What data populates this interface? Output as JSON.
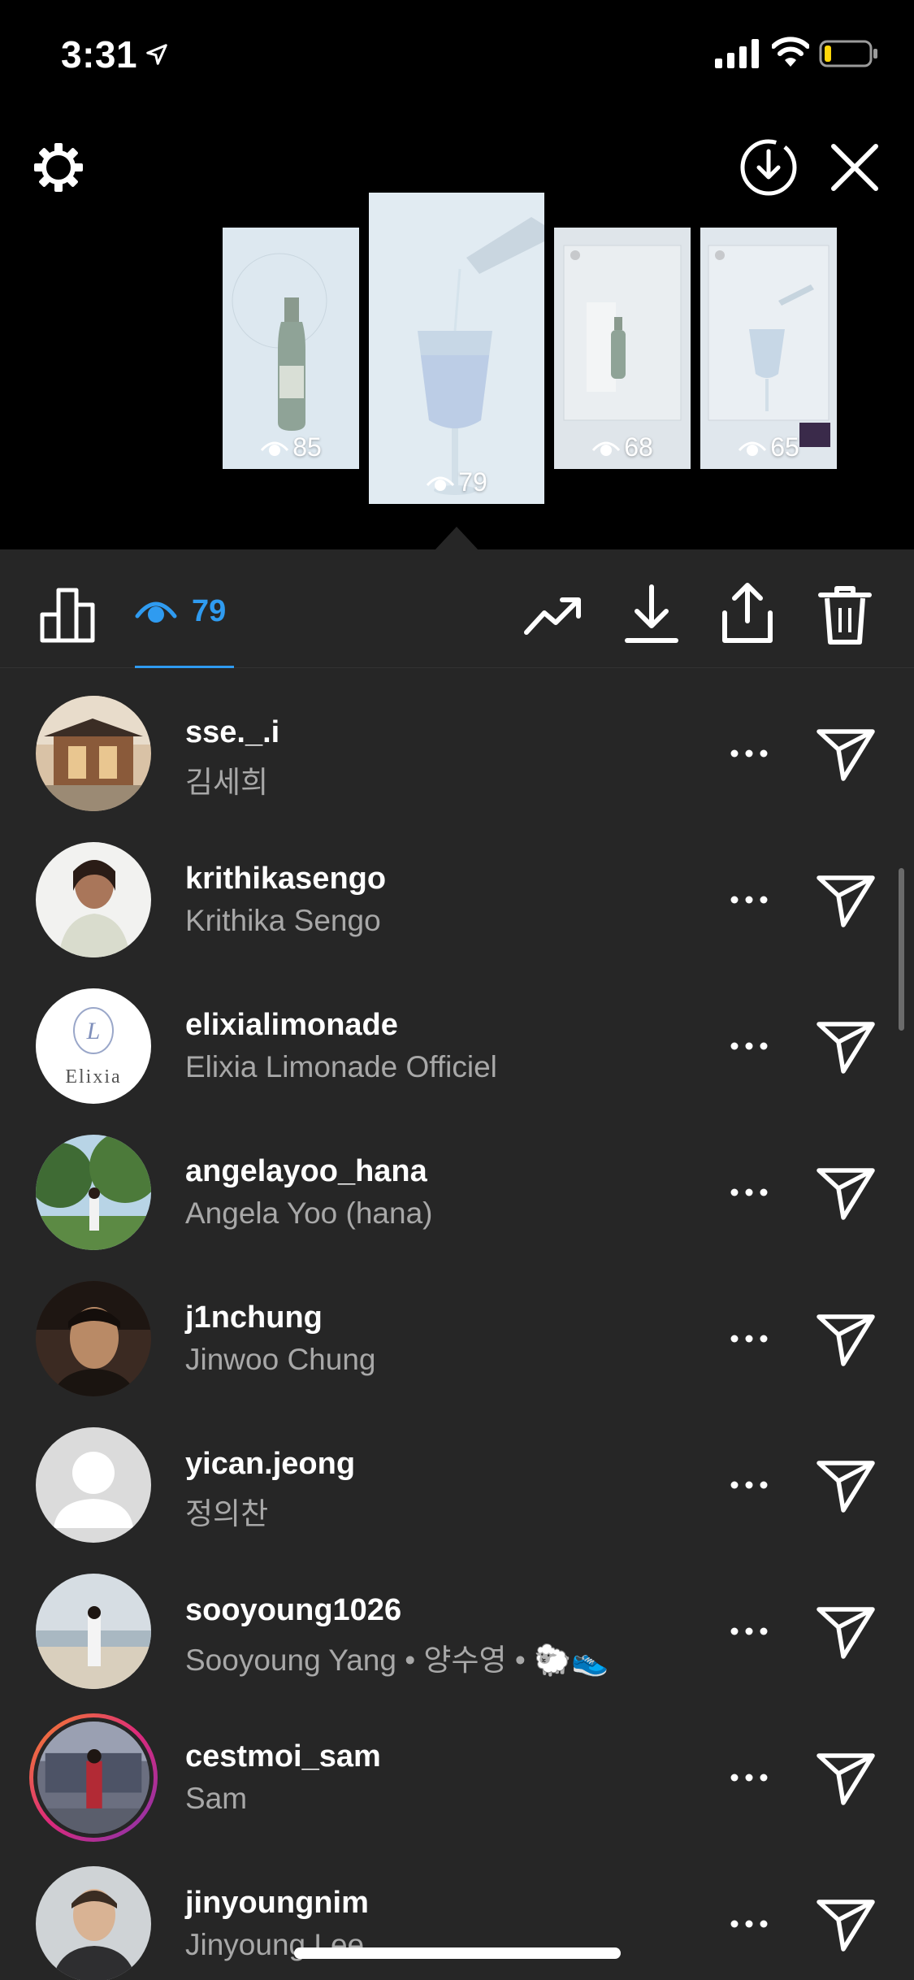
{
  "status_bar": {
    "time": "3:31"
  },
  "stories": [
    {
      "views": "85"
    },
    {
      "views": "79"
    },
    {
      "views": "68"
    },
    {
      "views": "65"
    }
  ],
  "toolbar": {
    "viewers_count": "79",
    "accent": "#2f9bf0"
  },
  "viewers": [
    {
      "username": "sse._.i",
      "full_name": "김세희"
    },
    {
      "username": "krithikasengo",
      "full_name": "Krithika Sengo"
    },
    {
      "username": "elixialimonade",
      "full_name": "Elixia Limonade Officiel",
      "avatar_text": "Elixia"
    },
    {
      "username": "angelayoo_hana",
      "full_name": "Angela Yoo (hana)"
    },
    {
      "username": "j1nchung",
      "full_name": "Jinwoo Chung"
    },
    {
      "username": "yican.jeong",
      "full_name": "정의찬"
    },
    {
      "username": "sooyoung1026",
      "full_name": "Sooyoung Yang • 양수영 • 🐑👟"
    },
    {
      "username": "cestmoi_sam",
      "full_name": "Sam"
    },
    {
      "username": "jinyoungnim",
      "full_name": "Jinyoung Lee"
    }
  ]
}
